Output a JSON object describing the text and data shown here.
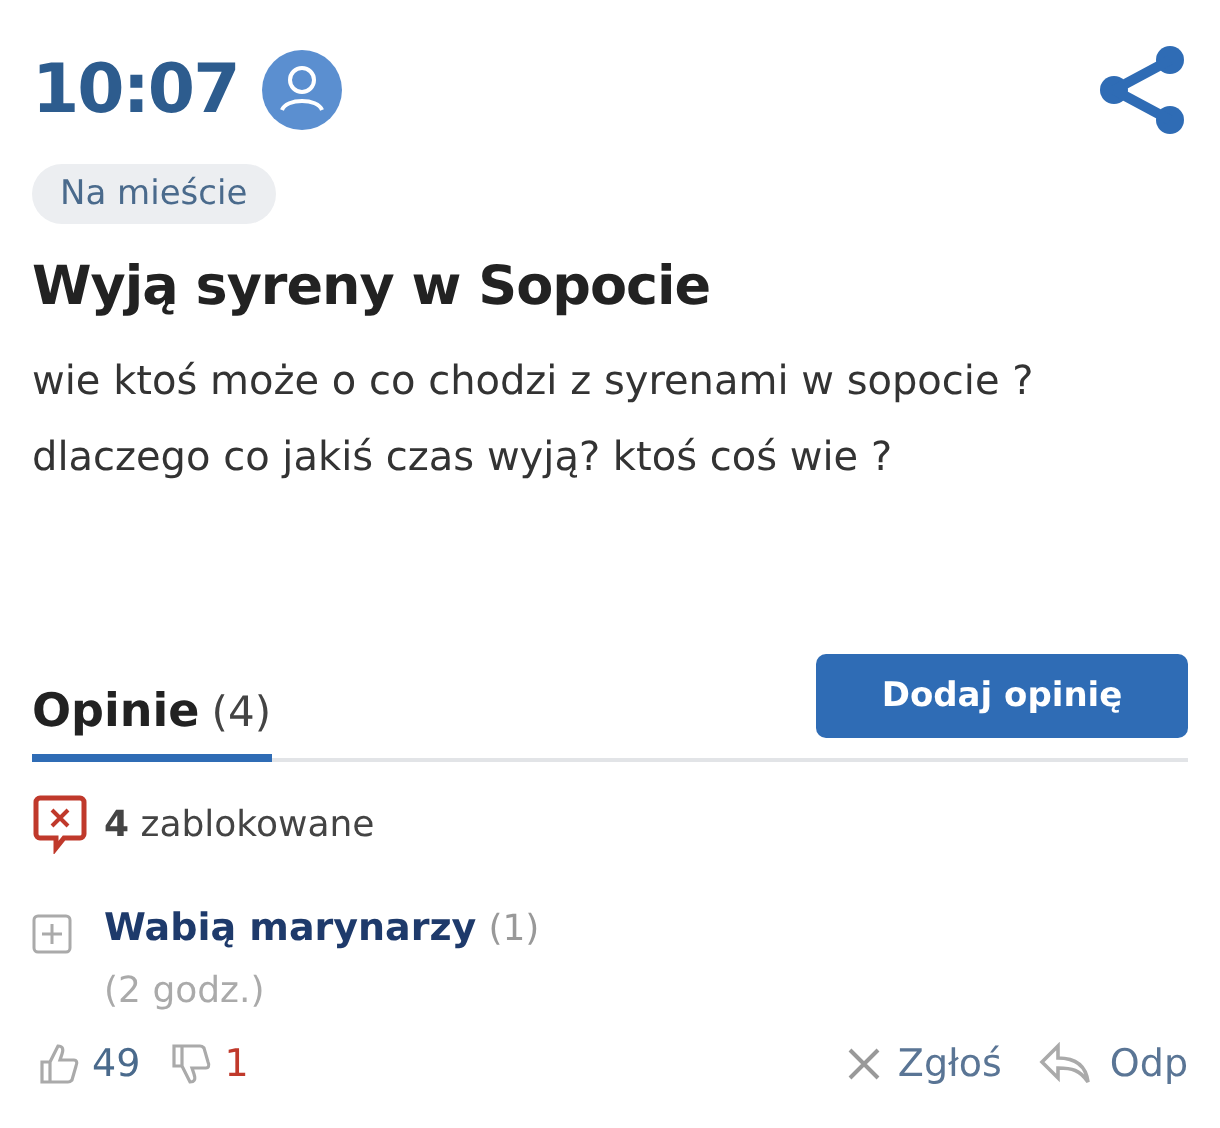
{
  "header": {
    "time": "10:07",
    "tag": "Na mieście"
  },
  "post": {
    "title": "Wyją syreny w Sopocie",
    "body": "wie ktoś może o co chodzi z syrenami w sopocie ? dlaczego co jakiś czas wyją? ktoś coś wie ?"
  },
  "opinions": {
    "heading": "Opinie",
    "count": "(4)",
    "add_button": "Dodaj opinię",
    "blocked": "**4** zablokowane"
  },
  "comments": [
    {
      "title": "Wabią marynarzy",
      "replies": "(1)",
      "age": "(2 godz.)",
      "likes": "49",
      "dislikes": "1",
      "report": "Zgłoś",
      "reply": "Odp"
    }
  ]
}
